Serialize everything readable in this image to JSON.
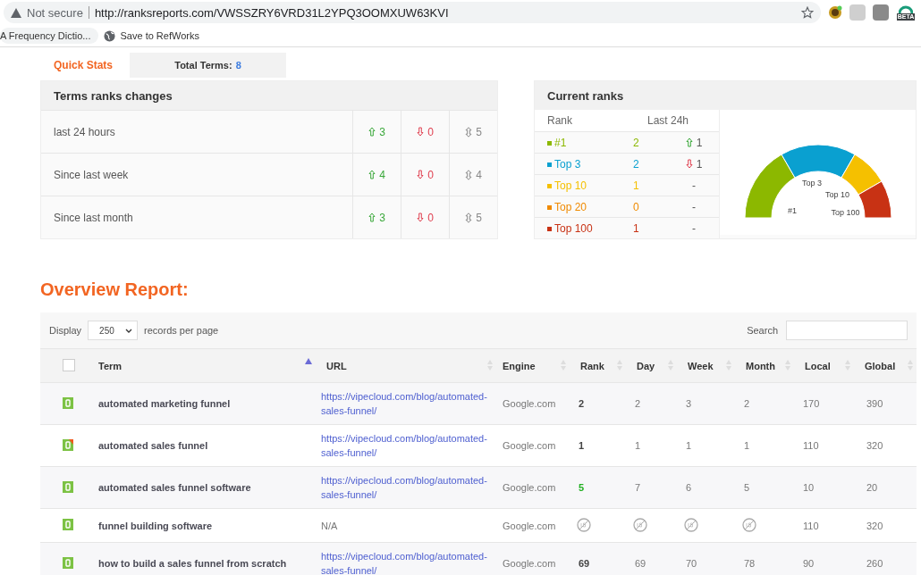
{
  "browser": {
    "security": "Not secure",
    "url": "http://ranksreports.com/VWSSZRY6VRD31L2YPQ3OOMXUW63KVI",
    "extension_badge": "BETA",
    "bookmarks": [
      {
        "label": "A Frequency Dictio...",
        "kind": "tab"
      },
      {
        "label": "Save to RefWorks",
        "kind": "globe"
      }
    ]
  },
  "quick_stats": {
    "tab": "Quick Stats",
    "total_label": "Total Terms:",
    "total_value": "8"
  },
  "changes": {
    "title": "Terms ranks changes",
    "rows": [
      {
        "label": "last 24 hours",
        "up": "3",
        "down": "0",
        "same": "5"
      },
      {
        "label": "Since last week",
        "up": "4",
        "down": "0",
        "same": "4"
      },
      {
        "label": "Since last month",
        "up": "3",
        "down": "0",
        "same": "5"
      }
    ]
  },
  "current": {
    "title": "Current ranks",
    "columns": [
      "Rank",
      "Last 24h"
    ],
    "rows": [
      {
        "name": "#1",
        "color": "#8cb800",
        "count": "2",
        "rose": true,
        "fell": false,
        "change": "1"
      },
      {
        "name": "Top 3",
        "color": "#0aa0d0",
        "count": "2",
        "rose": false,
        "fell": true,
        "change": "1"
      },
      {
        "name": "Top 10",
        "color": "#f5c000",
        "count": "1",
        "rose": false,
        "fell": false,
        "change": "-"
      },
      {
        "name": "Top 20",
        "color": "#f08a00",
        "count": "0",
        "rose": false,
        "fell": false,
        "change": "-"
      },
      {
        "name": "Top 100",
        "color": "#c83214",
        "count": "1",
        "rose": false,
        "fell": false,
        "change": "-"
      }
    ],
    "gauge_labels": [
      "#1",
      "Top 3",
      "Top 10",
      "Top 100"
    ]
  },
  "overview": {
    "title": "Overview Report:",
    "display_label": "Display",
    "page_size": "250",
    "records_label": "records per page",
    "search_label": "Search",
    "columns": [
      {
        "label": "Term",
        "sorted": true
      },
      {
        "label": "URL",
        "sorted": false
      },
      {
        "label": "Engine",
        "sorted": false
      },
      {
        "label": "Rank",
        "sorted": false
      },
      {
        "label": "Day",
        "sorted": false
      },
      {
        "label": "Week",
        "sorted": false
      },
      {
        "label": "Month",
        "sorted": false
      },
      {
        "label": "Local",
        "sorted": false
      },
      {
        "label": "Global",
        "sorted": false
      }
    ],
    "select_all": {
      "checked": false
    },
    "rows": [
      {
        "flagged": false,
        "term": "automated marketing funnel",
        "url": "https://vipecloud.com/blog/automated-sales-funnel/",
        "engine": "Google.com",
        "ranked": true,
        "improved": false,
        "rank": "2",
        "day": "2",
        "week": "3",
        "month": "2",
        "local": "170",
        "global": "390"
      },
      {
        "flagged": true,
        "term": "automated sales funnel",
        "url": "https://vipecloud.com/blog/automated-sales-funnel/",
        "engine": "Google.com",
        "ranked": true,
        "improved": false,
        "rank": "1",
        "day": "1",
        "week": "1",
        "month": "1",
        "local": "110",
        "global": "320"
      },
      {
        "flagged": false,
        "term": "automated sales funnel software",
        "url": "https://vipecloud.com/blog/automated-sales-funnel/",
        "engine": "Google.com",
        "ranked": true,
        "improved": true,
        "rank": "5",
        "day": "7",
        "week": "6",
        "month": "5",
        "local": "10",
        "global": "20"
      },
      {
        "flagged": false,
        "term": "funnel building software",
        "url": "N/A",
        "engine": "Google.com",
        "ranked": false,
        "local": "110",
        "global": "320"
      },
      {
        "flagged": false,
        "term": "how to build a sales funnel from scratch",
        "url": "https://vipecloud.com/blog/automated-sales-funnel/",
        "engine": "Google.com",
        "ranked": true,
        "improved": false,
        "rank": "69",
        "day": "69",
        "week": "70",
        "month": "78",
        "local": "90",
        "global": "260"
      }
    ]
  }
}
